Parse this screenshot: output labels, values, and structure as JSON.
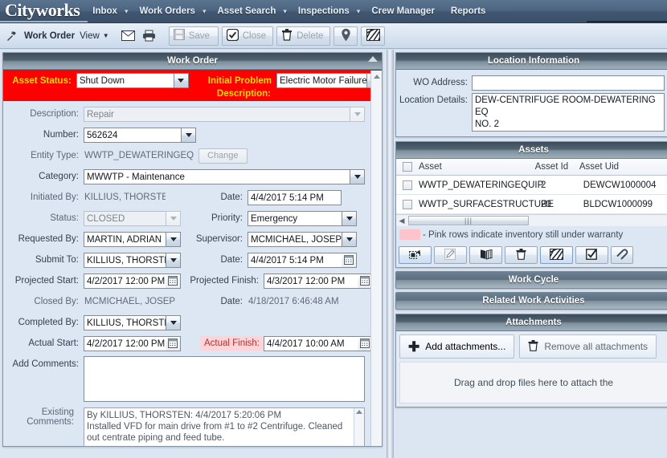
{
  "app": {
    "brand": "Cityworks"
  },
  "nav": {
    "items": [
      {
        "label": "Inbox",
        "caret": true
      },
      {
        "label": "Work Orders",
        "caret": true
      },
      {
        "label": "Asset Search",
        "caret": true
      },
      {
        "label": "Inspections",
        "caret": true
      },
      {
        "label": "Crew Manager",
        "caret": false
      },
      {
        "label": "Reports",
        "caret": false
      }
    ]
  },
  "toolbar": {
    "title": "Work Order",
    "view_label": "View",
    "email_icon": "envelope-icon",
    "print_icon": "printer-icon",
    "save_label": "Save",
    "close_label": "Close",
    "delete_label": "Delete",
    "map_icon": "map-pin-icon",
    "gis_icon": "gis-layer-icon"
  },
  "work_order": {
    "panel_title": "Work Order",
    "banner": {
      "asset_status_label": "Asset Status:",
      "asset_status_value": "Shut Down",
      "initial_problem_label_line1": "Initial Problem",
      "initial_problem_label_line2": "Description:",
      "initial_problem_value": "Electric Motor Failure"
    },
    "fields": {
      "description_label": "Description:",
      "description_value": "Repair",
      "number_label": "Number:",
      "number_value": "562624",
      "entity_type_label": "Entity Type:",
      "entity_type_value": "WWTP_DEWATERINGEQUIP",
      "change_label": "Change",
      "category_label": "Category:",
      "category_value": "MWWTP - Maintenance",
      "initiated_by_label": "Initiated By:",
      "initiated_by_value": "KILLIUS, THORSTEN",
      "initiated_date_label": "Date:",
      "initiated_date_value": "4/4/2017 5:14 PM",
      "status_label": "Status:",
      "status_value": "CLOSED",
      "priority_label": "Priority:",
      "priority_value": "Emergency",
      "requested_by_label": "Requested By:",
      "requested_by_value": "MARTIN, ADRIAN",
      "supervisor_label": "Supervisor:",
      "supervisor_value": "MCMICHAEL, JOSEPH",
      "submit_to_label": "Submit To:",
      "submit_to_value": "KILLIUS, THORSTEN",
      "submit_date_label": "Date:",
      "submit_date_value": "4/4/2017 5:14 PM",
      "projected_start_label": "Projected Start:",
      "projected_start_value": "4/2/2017 12:00 PM",
      "projected_finish_label": "Projected Finish:",
      "projected_finish_value": "4/3/2017 12:00 PM",
      "closed_by_label": "Closed By:",
      "closed_by_value": "MCMICHAEL, JOSEPH",
      "closed_date_label": "Date:",
      "closed_date_value": "4/18/2017 6:46:48 AM",
      "completed_by_label": "Completed By:",
      "completed_by_value": "KILLIUS, THORSTEN",
      "actual_start_label": "Actual Start:",
      "actual_start_value": "4/2/2017 12:00 PM",
      "actual_finish_label": "Actual Finish:",
      "actual_finish_value": "4/4/2017 10:00 AM",
      "add_comments_label": "Add Comments:",
      "add_comments_value": "",
      "existing_comments_label_line1": "Existing",
      "existing_comments_label_line2": "Comments:",
      "existing_comments_line1": "By KILLIUS, THORSTEN: 4/4/2017 5:20:06 PM",
      "existing_comments_line2": "Installed VFD for main drive from #1 to #2 Centrifuge. Cleaned",
      "existing_comments_line3": "out centrate piping and feed tube."
    }
  },
  "location": {
    "panel_title": "Location Information",
    "wo_address_label": "WO Address:",
    "wo_address_value": "",
    "location_details_label": "Location Details:",
    "location_details_line1": "DEW-CENTRIFUGE ROOM-DEWATERING EQ",
    "location_details_line2": "NO. 2"
  },
  "assets": {
    "panel_title": "Assets",
    "columns": [
      "Asset",
      "Asset Id",
      "Asset Uid"
    ],
    "rows": [
      {
        "asset": "WWTP_DEWATERINGEQUIP",
        "asset_id": "2",
        "asset_uid": "DEWCW1000004"
      },
      {
        "asset": "WWTP_SURFACESTRUCTURE",
        "asset_id": "20",
        "asset_uid": "BLDCW1000099"
      }
    ],
    "legend": "- Pink rows indicate inventory still under warranty",
    "legend_color": "#ffc3cb",
    "toolbar_icons": [
      "add-asset-icon",
      "edit-asset-icon",
      "map-book-icon",
      "delete-asset-icon",
      "gis-layer-icon",
      "checklist-icon",
      "attachment-icon"
    ]
  },
  "work_cycle": {
    "title": "Work Cycle"
  },
  "related_work": {
    "title": "Related Work Activities"
  },
  "attachments": {
    "panel_title": "Attachments",
    "add_label": "Add attachments...",
    "remove_label": "Remove all attachments",
    "dropzone_text": "Drag and drop files here to attach the",
    "add_icon": "plus-icon",
    "remove_icon": "trash-icon"
  }
}
